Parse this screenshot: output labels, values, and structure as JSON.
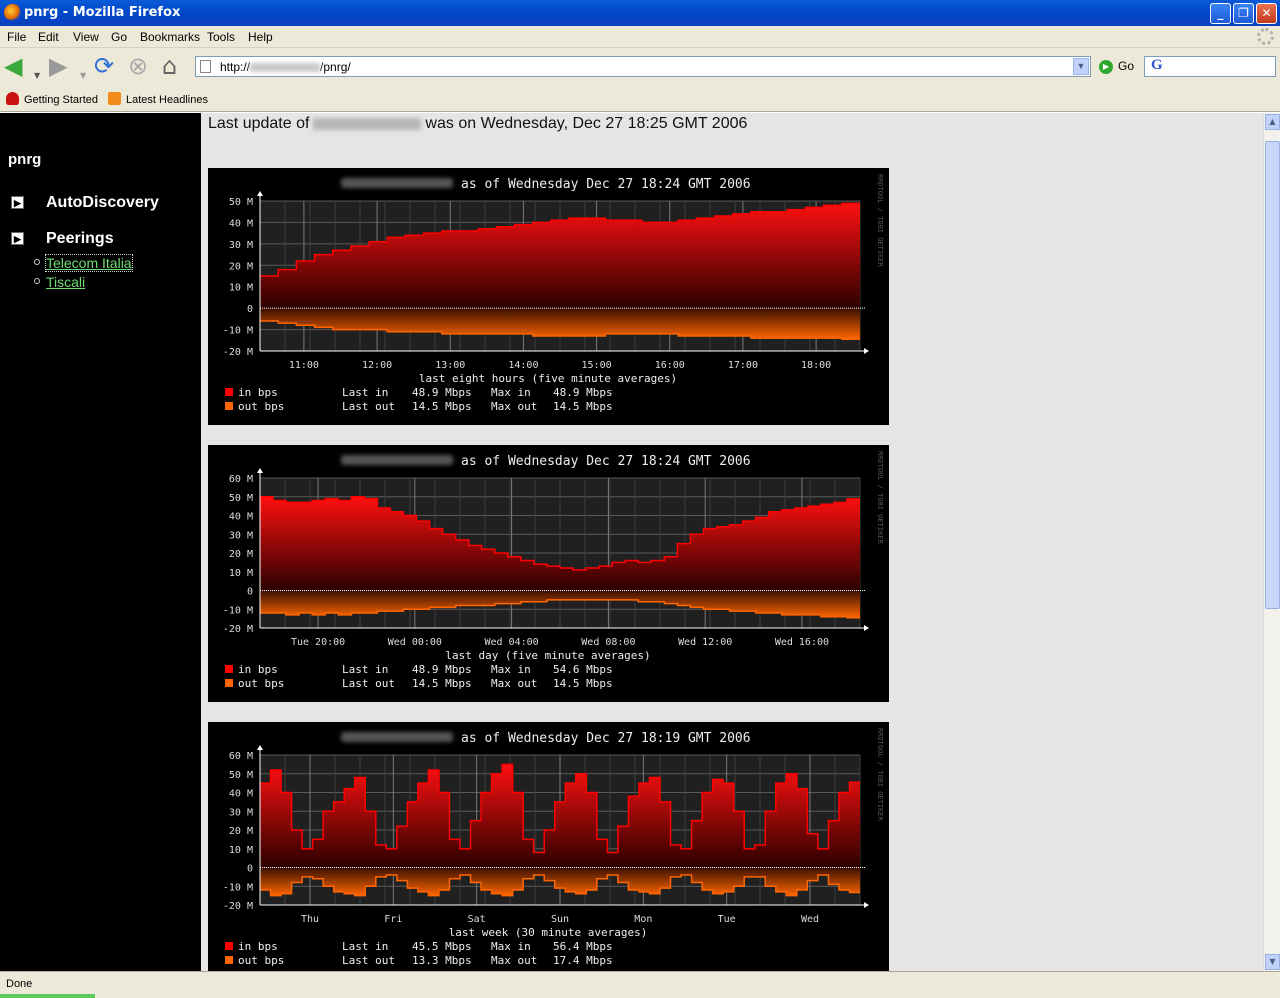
{
  "window": {
    "title": "pnrg - Mozilla Firefox",
    "minimize": "_",
    "maximize": "❐",
    "close": "✕"
  },
  "menu": [
    "File",
    "Edit",
    "View",
    "Go",
    "Bookmarks",
    "Tools",
    "Help"
  ],
  "navbar": {
    "url_prefix": "http://",
    "url_suffix": "/pnrg/",
    "go_label": "Go",
    "search_logo": "G"
  },
  "bookmarks": [
    {
      "label": "Getting Started",
      "icon": "redhat-icon"
    },
    {
      "label": "Latest Headlines",
      "icon": "rss-icon"
    }
  ],
  "sidebar": {
    "title": "pnrg",
    "items": [
      {
        "label": "AutoDiscovery"
      },
      {
        "label": "Peerings"
      }
    ],
    "links": [
      {
        "label": "Telecom Italia",
        "focused": true
      },
      {
        "label": "Tiscali",
        "focused": false
      }
    ]
  },
  "content": {
    "update_prefix": "Last update of",
    "update_suffix": "was on Wednesday, Dec 27 18:25 GMT 2006"
  },
  "colors": {
    "in": "#ff0000",
    "out": "#ff6600",
    "bg": "#000000",
    "grid": "#555555"
  },
  "chart_data": [
    {
      "type": "area",
      "title": "as of Wednesday Dec 27 18:24 GMT 2006",
      "xlabel": "last eight hours (five minute averages)",
      "watermark": "RRDTOOL / TOBI OETIKER",
      "y_ticks": [
        "50 M",
        "40 M",
        "30 M",
        "20 M",
        "10 M",
        "0",
        "-10 M",
        "-20 M"
      ],
      "ylim": [
        -20,
        50
      ],
      "x_ticks": [
        "11:00",
        "12:00",
        "13:00",
        "14:00",
        "15:00",
        "16:00",
        "17:00",
        "18:00"
      ],
      "series": [
        {
          "name": "in bps",
          "values": [
            15,
            18,
            22,
            25,
            27,
            29,
            31,
            33,
            34,
            35,
            36,
            36,
            37,
            38,
            39,
            40,
            41,
            42,
            42,
            41,
            41,
            40,
            40,
            41,
            42,
            43,
            44,
            45,
            45,
            46,
            47,
            48,
            48.9
          ]
        },
        {
          "name": "out bps",
          "values": [
            -6,
            -7,
            -8,
            -9,
            -10,
            -10,
            -10,
            -11,
            -11,
            -11,
            -12,
            -12,
            -12,
            -12,
            -12,
            -13,
            -13,
            -13,
            -13,
            -12,
            -12,
            -12,
            -12,
            -13,
            -13,
            -13,
            -13,
            -14,
            -14,
            -14,
            -14,
            -14,
            -14.5
          ]
        }
      ],
      "legend": [
        {
          "label": "in bps",
          "last_label": "Last in",
          "last": "48.9 Mbps",
          "max_label": "Max in",
          "max": "48.9 Mbps"
        },
        {
          "label": "out bps",
          "last_label": "Last out",
          "last": "14.5 Mbps",
          "max_label": "Max out",
          "max": "14.5 Mbps"
        }
      ]
    },
    {
      "type": "area",
      "title": "as of Wednesday Dec 27 18:24 GMT 2006",
      "xlabel": "last day (five minute averages)",
      "watermark": "RRDTOOL / TOBI OETIKER",
      "y_ticks": [
        "60 M",
        "50 M",
        "40 M",
        "30 M",
        "20 M",
        "10 M",
        "0",
        "-10 M",
        "-20 M"
      ],
      "ylim": [
        -20,
        60
      ],
      "x_ticks": [
        "Tue 20:00",
        "Wed 00:00",
        "Wed 04:00",
        "Wed 08:00",
        "Wed 12:00",
        "Wed 16:00"
      ],
      "series": [
        {
          "name": "in bps",
          "values": [
            50,
            48,
            47,
            47,
            48,
            49,
            48,
            50,
            49,
            44,
            42,
            40,
            37,
            33,
            30,
            27,
            24,
            22,
            20,
            18,
            16,
            14,
            13,
            12,
            11,
            12,
            13,
            15,
            16,
            15,
            16,
            18,
            25,
            30,
            33,
            34,
            35,
            37,
            39,
            42,
            43,
            44,
            45,
            46,
            47,
            48.9
          ]
        },
        {
          "name": "out bps",
          "values": [
            -12,
            -12,
            -13,
            -12,
            -13,
            -12,
            -13,
            -12,
            -12,
            -11,
            -11,
            -10,
            -10,
            -9,
            -9,
            -8,
            -8,
            -8,
            -7,
            -7,
            -6,
            -6,
            -5,
            -5,
            -5,
            -5,
            -5,
            -5,
            -5,
            -6,
            -6,
            -7,
            -8,
            -9,
            -10,
            -10,
            -11,
            -11,
            -12,
            -12,
            -13,
            -13,
            -13,
            -14,
            -14,
            -14.5
          ]
        }
      ],
      "legend": [
        {
          "label": "in bps",
          "last_label": "Last in",
          "last": "48.9 Mbps",
          "max_label": "Max in",
          "max": "54.6 Mbps"
        },
        {
          "label": "out bps",
          "last_label": "Last out",
          "last": "14.5 Mbps",
          "max_label": "Max out",
          "max": "14.5 Mbps"
        }
      ]
    },
    {
      "type": "area",
      "title": "as of Wednesday Dec 27 18:19 GMT 2006",
      "xlabel": "last week (30 minute averages)",
      "watermark": "RRDTOOL / TOBI OETIKER",
      "y_ticks": [
        "60 M",
        "50 M",
        "40 M",
        "30 M",
        "20 M",
        "10 M",
        "0",
        "-10 M",
        "-20 M"
      ],
      "ylim": [
        -20,
        60
      ],
      "x_ticks": [
        "Thu",
        "Fri",
        "Sat",
        "Sun",
        "Mon",
        "Tue",
        "Wed"
      ],
      "series": [
        {
          "name": "in bps",
          "values": [
            45,
            52,
            40,
            20,
            10,
            15,
            30,
            35,
            42,
            48,
            30,
            12,
            10,
            22,
            35,
            45,
            52,
            40,
            15,
            10,
            25,
            40,
            50,
            55,
            40,
            15,
            8,
            20,
            35,
            45,
            50,
            40,
            15,
            8,
            22,
            38,
            45,
            48,
            35,
            12,
            10,
            25,
            40,
            47,
            45,
            30,
            10,
            12,
            30,
            45,
            50,
            42,
            18,
            10,
            25,
            40,
            45.5
          ]
        },
        {
          "name": "out bps",
          "values": [
            -12,
            -15,
            -14,
            -8,
            -5,
            -6,
            -10,
            -13,
            -14,
            -15,
            -10,
            -5,
            -4,
            -7,
            -11,
            -13,
            -15,
            -12,
            -6,
            -4,
            -8,
            -12,
            -14,
            -15,
            -12,
            -6,
            -4,
            -7,
            -11,
            -13,
            -14,
            -12,
            -6,
            -4,
            -8,
            -12,
            -13,
            -14,
            -11,
            -5,
            -4,
            -8,
            -12,
            -14,
            -13,
            -10,
            -5,
            -5,
            -10,
            -13,
            -15,
            -12,
            -7,
            -4,
            -9,
            -12,
            -13.3
          ]
        }
      ],
      "legend": [
        {
          "label": "in bps",
          "last_label": "Last in",
          "last": "45.5 Mbps",
          "max_label": "Max in",
          "max": "56.4 Mbps"
        },
        {
          "label": "out bps",
          "last_label": "Last out",
          "last": "13.3 Mbps",
          "max_label": "Max out",
          "max": "17.4 Mbps"
        }
      ]
    }
  ],
  "statusbar": {
    "text": "Done"
  }
}
